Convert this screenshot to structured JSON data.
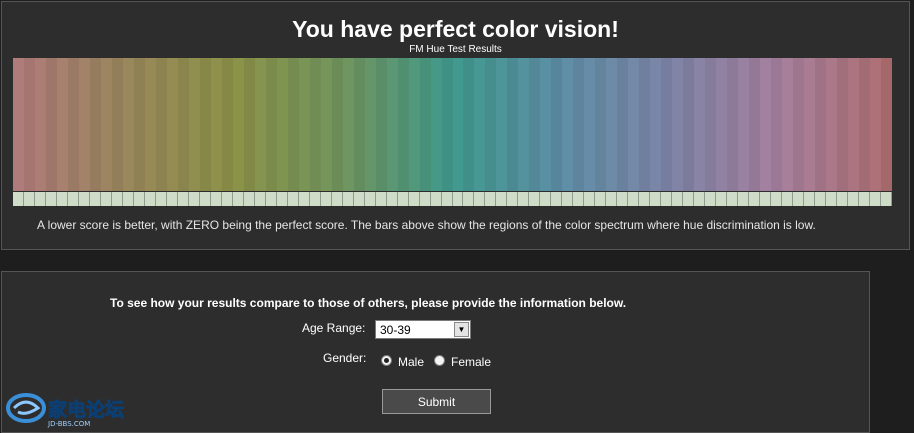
{
  "results": {
    "title": "You have perfect color vision!",
    "subtitle": "FM Hue Test Results",
    "note": "A lower score is better, with ZERO being the perfect score. The bars above show the regions of the color spectrum where hue discrimination is low.",
    "spectrum_stops": [
      "#b17a7d",
      "#9a875c",
      "#8c9348",
      "#71955e",
      "#3f9a8e",
      "#5f8ea7",
      "#7f84a8",
      "#a7809d",
      "#ae6e70"
    ],
    "bar_count": 80,
    "bar_color": "#cfdcc8"
  },
  "form": {
    "prompt": "To see how your results compare to those of others, please provide the information below.",
    "age_label": "Age Range:",
    "age_value": "30-39",
    "gender_label": "Gender:",
    "gender_options": [
      {
        "label": "Male",
        "checked": true
      },
      {
        "label": "Female",
        "checked": false
      }
    ],
    "submit_label": "Submit"
  },
  "watermark": {
    "logo_icon": "jd-bbs-logo-icon",
    "text": "家电论坛",
    "url_text": "JD-BBS.COM"
  }
}
